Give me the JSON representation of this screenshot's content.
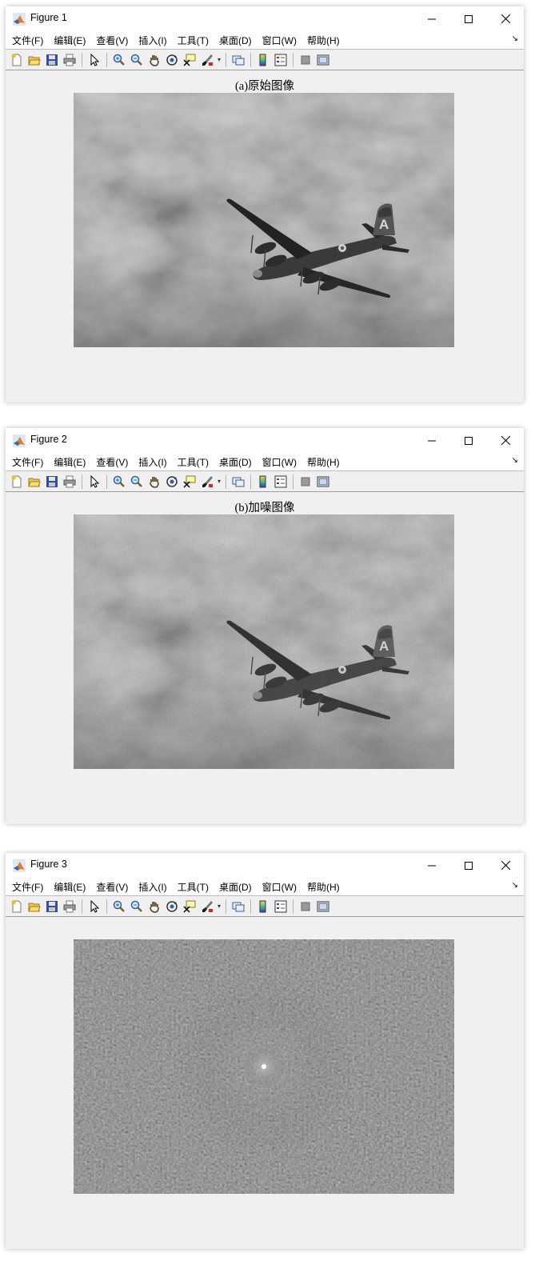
{
  "menu": {
    "items": [
      "文件(F)",
      "编辑(E)",
      "查看(V)",
      "插入(I)",
      "工具(T)",
      "桌面(D)",
      "窗口(W)",
      "帮助(H)"
    ],
    "overflow_arrow": "↘"
  },
  "toolbar_icons": [
    "new-figure-icon",
    "open-file-icon",
    "save-icon",
    "print-icon",
    "select-arrow-icon",
    "zoom-in-icon",
    "zoom-out-icon",
    "pan-hand-icon",
    "rotate-3d-icon",
    "data-cursor-icon",
    "brush-icon",
    "brush-dropdown-icon",
    "link-plot-icon",
    "colorbar-icon",
    "legend-icon",
    "hide-plot-tools-icon",
    "show-plot-tools-icon"
  ],
  "figures": [
    {
      "title": "Figure 1",
      "axes_title": "(a)原始图像",
      "image_content": "grayscale photo: B-29 bomber with tail letter A flying in a cloudy sky",
      "tail_letter": "A"
    },
    {
      "title": "Figure 2",
      "axes_title": "(b)加噪图像",
      "image_content": "grayscale photo: B-29 bomber with tail letter A flying in a cloudy sky",
      "tail_letter": "A"
    },
    {
      "title": "Figure 3",
      "axes_title": "",
      "image_content": "centered Fourier magnitude spectrum: bright central point with radiating diagonal streaks on a dark background"
    }
  ],
  "colors": {
    "window_bg": "#f0f0f0",
    "titlebar_bg": "#ffffff",
    "sky_gray": "#9a9a9a",
    "plane_dark": "#2e2e2e",
    "spectrum_bg": "#111111"
  }
}
